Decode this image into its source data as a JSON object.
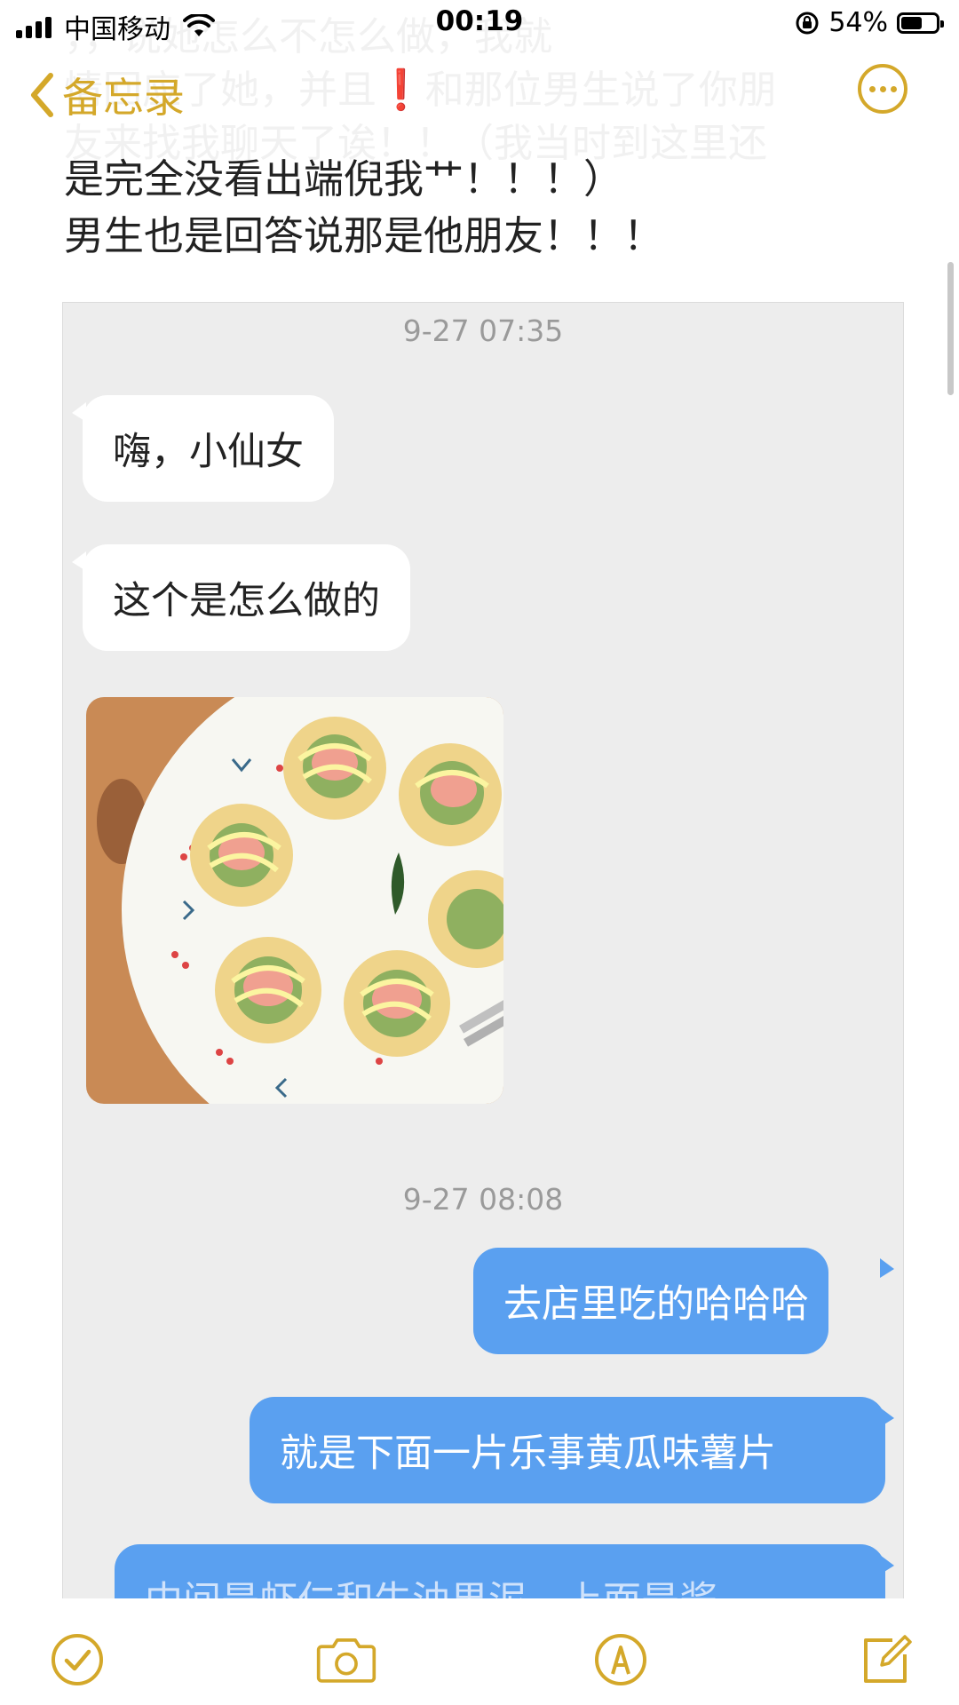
{
  "status_bar": {
    "carrier": "中国移动",
    "time": "00:19",
    "battery": "54%"
  },
  "nav": {
    "back_label": "备忘录",
    "faded_lines": [
      "，，说她怎么不怎么做，我就",
      "情回应了她，并且❗和那位男生说了你朋",
      "友来找我聊天了诶！！（我当时到这里还"
    ]
  },
  "note": {
    "lines": [
      "是完全没看出端倪我艹！！！）",
      "男生也是回答说那是他朋友！！！"
    ]
  },
  "chat": {
    "timestamp1": "9-27 07:35",
    "msg1": "嗨，小仙女",
    "msg2": "这个是怎么做的",
    "timestamp2": "9-27 08:08",
    "reply1": "去店里吃的哈哈哈",
    "reply2": "就是下面一片乐事黄瓜味薯片",
    "reply3_partial": "中间是虾仁和牛油果泥，上面是酱"
  },
  "toolbar": {
    "icons": [
      "checklist-icon",
      "camera-icon",
      "markup-icon",
      "compose-icon"
    ]
  },
  "colors": {
    "accent": "#d4a82a",
    "outgoing_bubble": "#5aa0f0",
    "chat_background": "#ededed"
  }
}
